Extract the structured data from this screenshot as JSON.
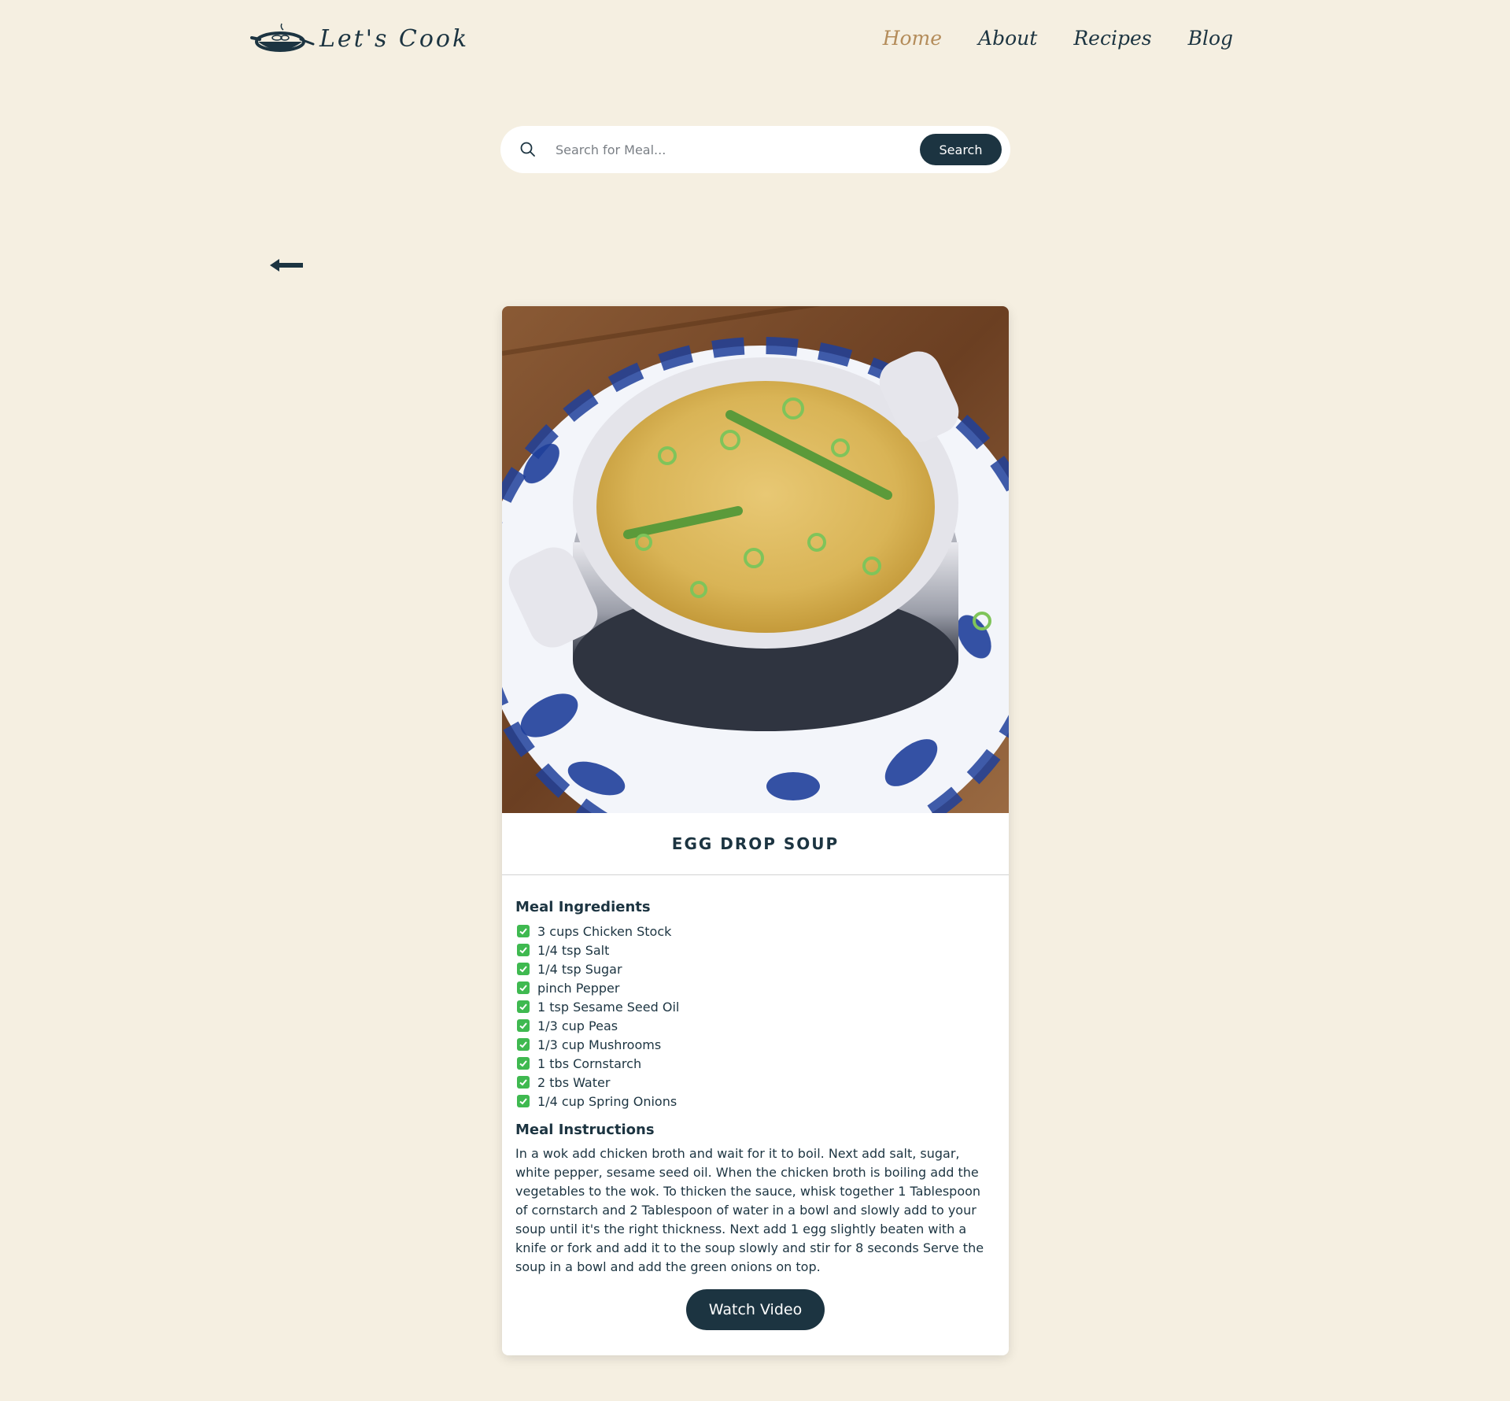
{
  "header": {
    "logo_text": "Let's Cook",
    "nav": [
      {
        "label": "Home",
        "active": true
      },
      {
        "label": "About",
        "active": false
      },
      {
        "label": "Recipes",
        "active": false
      },
      {
        "label": "Blog",
        "active": false
      }
    ]
  },
  "search": {
    "placeholder": "Search for Meal...",
    "button_label": "Search"
  },
  "back_icon": "arrow-left-icon",
  "meal": {
    "title": "EGG DROP SOUP",
    "ingredients_heading": "Meal Ingredients",
    "ingredients": [
      "3 cups Chicken Stock",
      "1/4 tsp Salt",
      "1/4 tsp Sugar",
      "pinch Pepper",
      "1 tsp Sesame Seed Oil",
      "1/3 cup Peas",
      "1/3 cup Mushrooms",
      "1 tbs Cornstarch",
      "2 tbs Water",
      "1/4 cup Spring Onions"
    ],
    "instructions_heading": "Meal Instructions",
    "instructions": "In a wok add chicken broth and wait for it to boil. Next add salt, sugar, white pepper, sesame seed oil. When the chicken broth is boiling add the vegetables to the wok. To thicken the sauce, whisk together 1 Tablespoon of cornstarch and 2 Tablespoon of water in a bowl and slowly add to your soup until it's the right thickness. Next add 1 egg slightly beaten with a knife or fork and add it to the soup slowly and stir for 8 seconds Serve the soup in a bowl and add the green onions on top.",
    "video_button_label": "Watch Video"
  },
  "colors": {
    "background": "#f5efe1",
    "primary": "#1c3441",
    "active_nav": "#b48c5a",
    "check": "#3fb950"
  }
}
